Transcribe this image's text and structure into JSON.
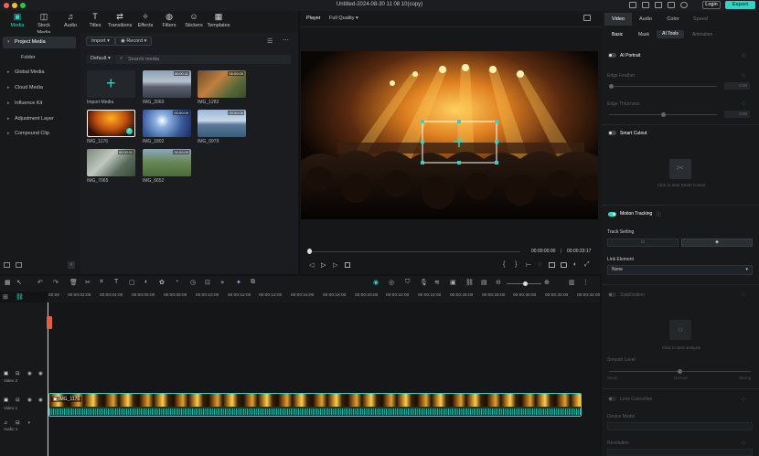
{
  "window": {
    "title": "Untitled-2024-08-30 11 08 10(copy)",
    "login_label": "Login",
    "export_label": "Export"
  },
  "toolbar": {
    "items": [
      {
        "label": "Media",
        "icon": "media-icon",
        "glyph": "▣"
      },
      {
        "label": "Stock Media",
        "icon": "stock-media-icon",
        "glyph": "◫"
      },
      {
        "label": "Audio",
        "icon": "audio-icon",
        "glyph": "♫"
      },
      {
        "label": "Titles",
        "icon": "titles-icon",
        "glyph": "T"
      },
      {
        "label": "Transitions",
        "icon": "transitions-icon",
        "glyph": "⇄"
      },
      {
        "label": "Effects",
        "icon": "effects-icon",
        "glyph": "✧"
      },
      {
        "label": "Filters",
        "icon": "filters-icon",
        "glyph": "◍"
      },
      {
        "label": "Stickers",
        "icon": "stickers-icon",
        "glyph": "☺"
      },
      {
        "label": "Templates",
        "icon": "templates-icon",
        "glyph": "▦"
      }
    ]
  },
  "sidebar": {
    "items": [
      "Project Media",
      "Folder",
      "Global Media",
      "Cloud Media",
      "Influence Kit",
      "Adjustment Layer",
      "Compound Clip"
    ]
  },
  "media": {
    "import_label": "Import",
    "record_label": "Record",
    "sort_label": "Default",
    "search_placeholder": "Search media",
    "items": [
      {
        "name": "Import Media",
        "duration": ""
      },
      {
        "name": "IMG_2060",
        "duration": "00:00:11"
      },
      {
        "name": "IMG_1282",
        "duration": "00:00:05"
      },
      {
        "name": "IMG_1176",
        "duration": ""
      },
      {
        "name": "IMG_1802",
        "duration": "00:00:09"
      },
      {
        "name": "IMG_0979",
        "duration": "00:00:06"
      },
      {
        "name": "IMG_7065",
        "duration": "00:00:11"
      },
      {
        "name": "IMG_6652",
        "duration": "00:00:09"
      }
    ]
  },
  "player": {
    "tab_label": "Player",
    "quality": "Full Quality",
    "current_time": "00:00:00:00",
    "total_time": "00:00:33:17"
  },
  "right_panel": {
    "tabs": [
      "Video",
      "Audio",
      "Color",
      "Speed"
    ],
    "subtabs": [
      "Basic",
      "Mask",
      "AI Tools",
      "Animation"
    ],
    "ai_portrait": "AI Portrait",
    "edge_feather": "Edge Feather",
    "edge_thickness": "Edge Thickness",
    "value_zero": "0.00",
    "smart_cutout": "Smart Cutout",
    "smart_cutout_hint": "Click to start Smart Cutout",
    "motion_tracking": "Motion Tracking",
    "track_setting": "Track Setting",
    "link_element": "Link Element",
    "link_value": "None",
    "stabilization": "Stabilization",
    "analysis_hint": "Click to start analysis",
    "smooth_level": "Smooth Level",
    "smooth_labels": [
      "Weak",
      "Normal",
      "Strong"
    ],
    "lens_correction": "Lens Correction",
    "device_model": "Device Model",
    "resolution": "Resolution"
  },
  "timeline": {
    "ticks": [
      "00:00",
      "00:00:02:00",
      "00:00:04:00",
      "00:00:06:00",
      "00:00:08:00",
      "00:00:10:00",
      "00:00:12:00",
      "00:00:14:00",
      "00:00:16:00",
      "00:00:18:00",
      "00:00:20:00",
      "00:00:22:00",
      "00:00:24:00",
      "00:00:26:00",
      "00:00:28:00",
      "00:00:30:00",
      "00:00:32:00",
      "00:00:34:00"
    ],
    "track_video2": "Video 2",
    "track_video1": "Video 1",
    "track_audio1": "Audio 1",
    "clip_name": "IMG_1176"
  },
  "colors": {
    "accent": "#2fd4c4"
  }
}
